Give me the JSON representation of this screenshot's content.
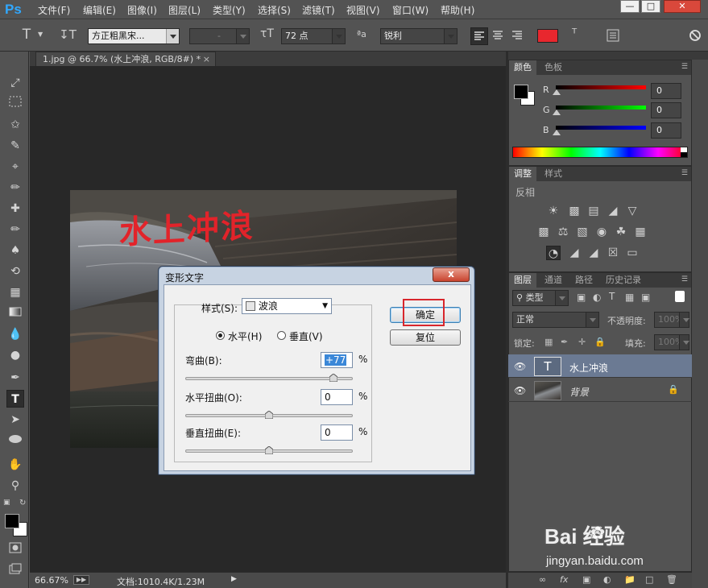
{
  "app": {
    "logo": "Ps",
    "menu": [
      "文件(F)",
      "编辑(E)",
      "图像(I)",
      "图层(L)",
      "类型(Y)",
      "选择(S)",
      "滤镜(T)",
      "视图(V)",
      "窗口(W)",
      "帮助(H)"
    ]
  },
  "options": {
    "font_family": "方正粗黑宋...",
    "font_style": "-",
    "font_size": "72 点",
    "aa_label": "ªa",
    "antialias": "锐利",
    "text_color": "#e8272e"
  },
  "document": {
    "tab_title": "1.jpg @ 66.7% (水上冲浪, RGB/8#) *",
    "canvas_text": "水上冲浪",
    "zoom": "66.67%",
    "doc_info": "文档:1010.4K/1.23M"
  },
  "color_panel": {
    "tabs": [
      "颜色",
      "色板"
    ],
    "channels": [
      {
        "label": "R",
        "value": "0",
        "gradient_end": "#ff0000"
      },
      {
        "label": "G",
        "value": "0",
        "gradient_end": "#00ff00"
      },
      {
        "label": "B",
        "value": "0",
        "gradient_end": "#0000ff"
      }
    ]
  },
  "adjust_panel": {
    "tabs": [
      "调整",
      "样式"
    ],
    "heading": "反相"
  },
  "layers_panel": {
    "tabs": [
      "图层",
      "通道",
      "路径",
      "历史记录"
    ],
    "filter_kind": "类型",
    "blend_mode": "正常",
    "opacity_label": "不透明度:",
    "opacity_value": "100%",
    "lock_label": "锁定:",
    "fill_label": "填充:",
    "fill_value": "100%",
    "layers": [
      {
        "name": "水上冲浪",
        "thumb": "T",
        "selected": true
      },
      {
        "name": "背景",
        "thumb": "",
        "selected": false
      }
    ]
  },
  "warp_dialog": {
    "title": "变形文字",
    "style_label": "样式(S):",
    "style_value": "波浪",
    "horizontal_label": "水平(H)",
    "vertical_label": "垂直(V)",
    "orientation": "horizontal",
    "bend_label": "弯曲(B):",
    "bend_value": "+77",
    "bend_fraction": 0.885,
    "hdistort_label": "水平扭曲(O):",
    "hdistort_value": "0",
    "hdistort_fraction": 0.5,
    "vdistort_label": "垂直扭曲(E):",
    "vdistort_value": "0",
    "vdistort_fraction": 0.5,
    "percent": "%",
    "ok_label": "确定",
    "reset_label": "复位",
    "close_glyph": "x"
  },
  "watermark": {
    "brand": "Bai  经验",
    "url": "jingyan.baidu.com"
  }
}
